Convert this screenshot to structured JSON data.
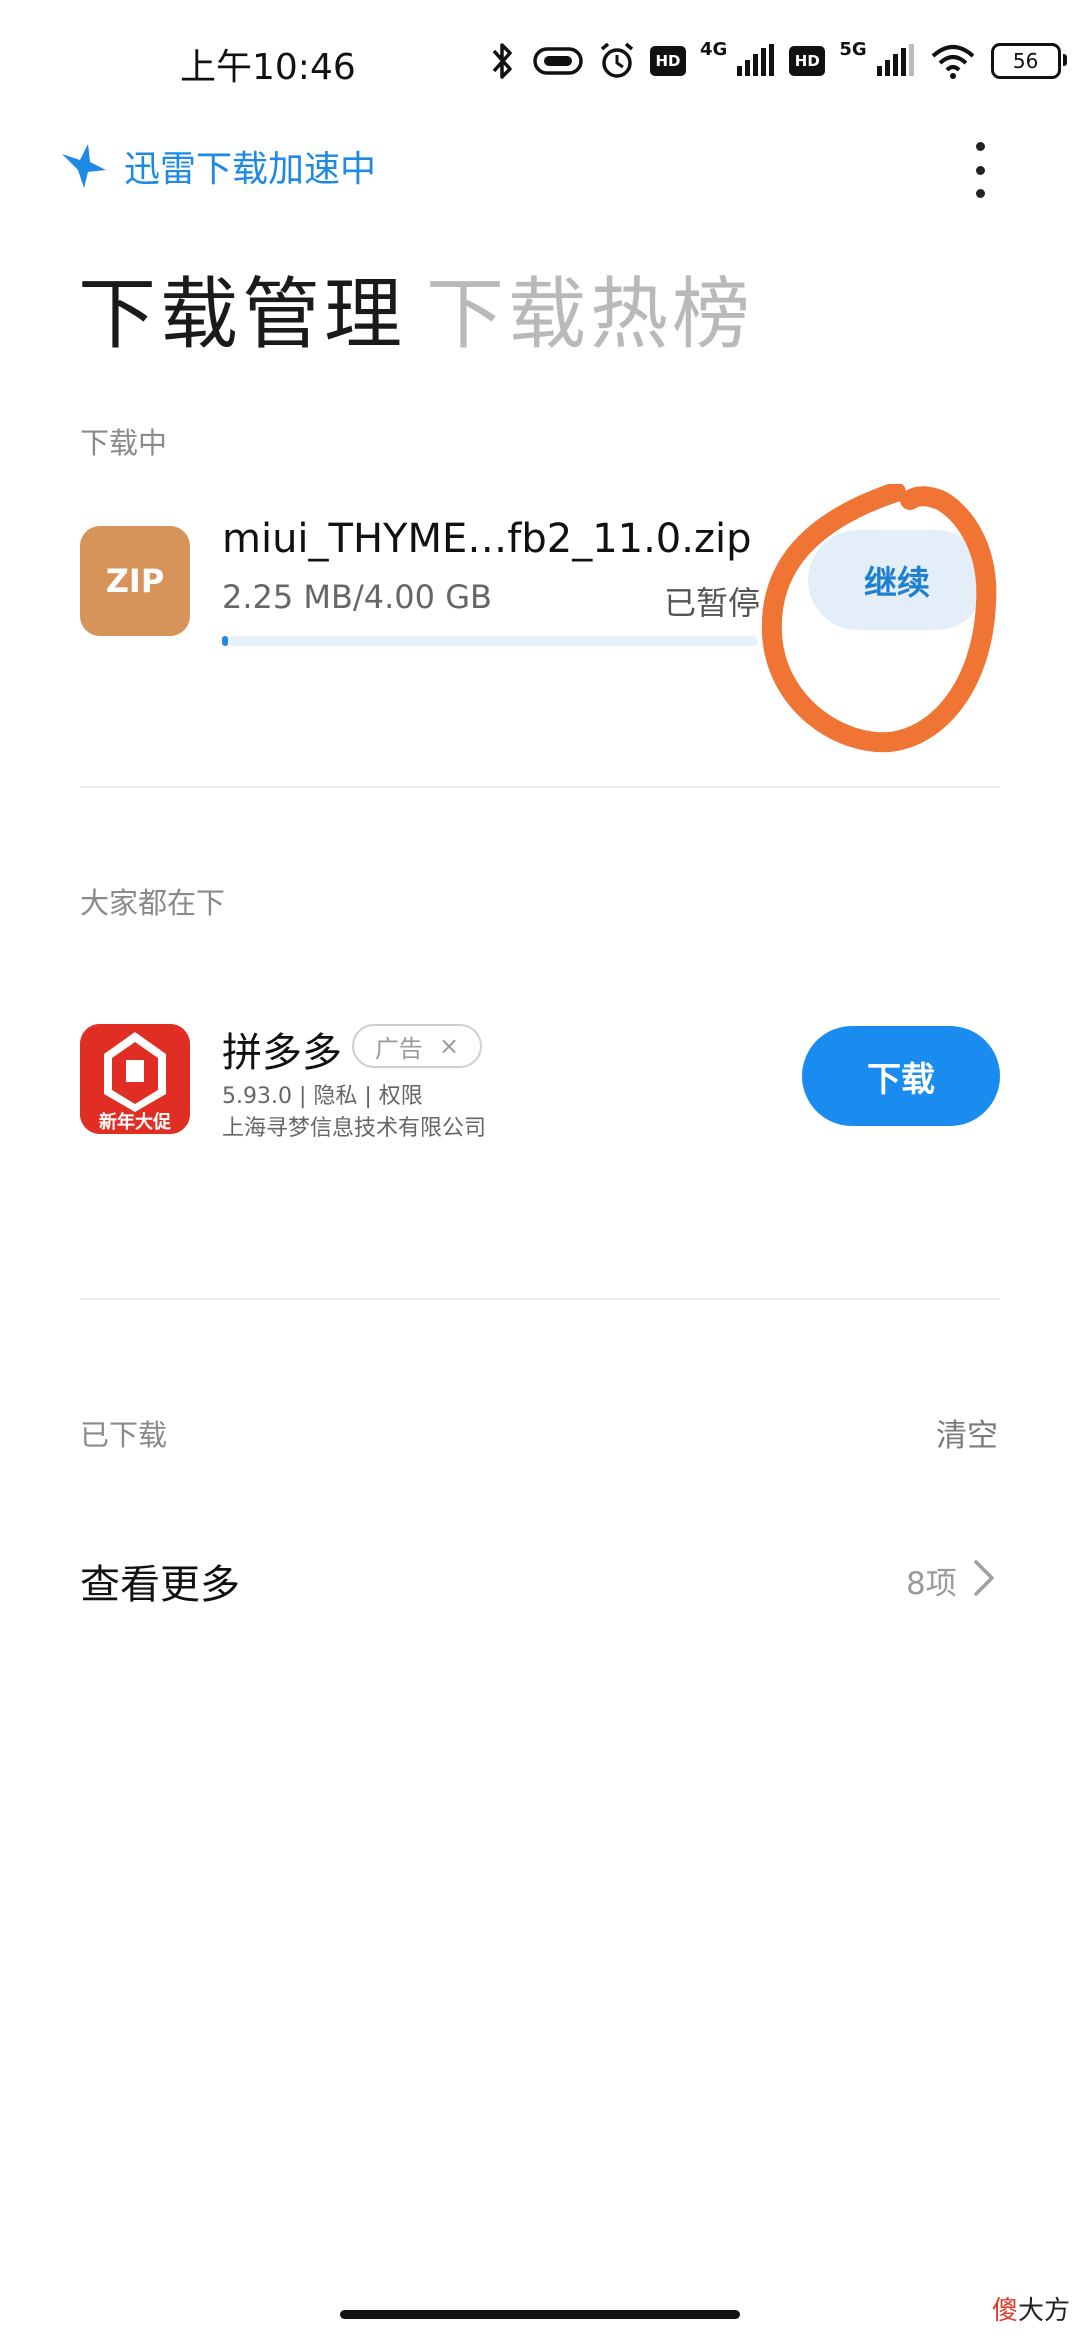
{
  "status_bar": {
    "time": "上午10:46",
    "hd1": "HD",
    "net1": "4G",
    "hd2": "HD",
    "net2": "5G",
    "battery": "56"
  },
  "header": {
    "brand": "迅雷下载加速中",
    "brand_color": "#1f8ae6",
    "tabs": [
      {
        "label": "下载管理",
        "active": true
      },
      {
        "label": "下载热榜",
        "active": false
      }
    ]
  },
  "downloading": {
    "section_title": "下载中",
    "items": [
      {
        "icon_text": "ZIP",
        "name": "miui_THYME…fb2_11.0.zip",
        "size": "2.25 MB/4.00 GB",
        "status": "已暂停",
        "progress": 0.0006,
        "action": "继续"
      }
    ]
  },
  "recommend": {
    "section_title": "大家都在下",
    "app": {
      "name": "拼多多",
      "ad_label": "广告",
      "ad_close": "×",
      "meta": "5.93.0 | 隐私 | 权限",
      "company": "上海寻梦信息技术有限公司",
      "icon_caption": "新年大促",
      "icon_color": "#e02e24",
      "action": "下载"
    }
  },
  "downloaded": {
    "section_title": "已下载",
    "clear": "清空",
    "see_more": "查看更多",
    "count": "8项"
  },
  "watermark": {
    "first": "傻",
    "rest": "大方"
  }
}
